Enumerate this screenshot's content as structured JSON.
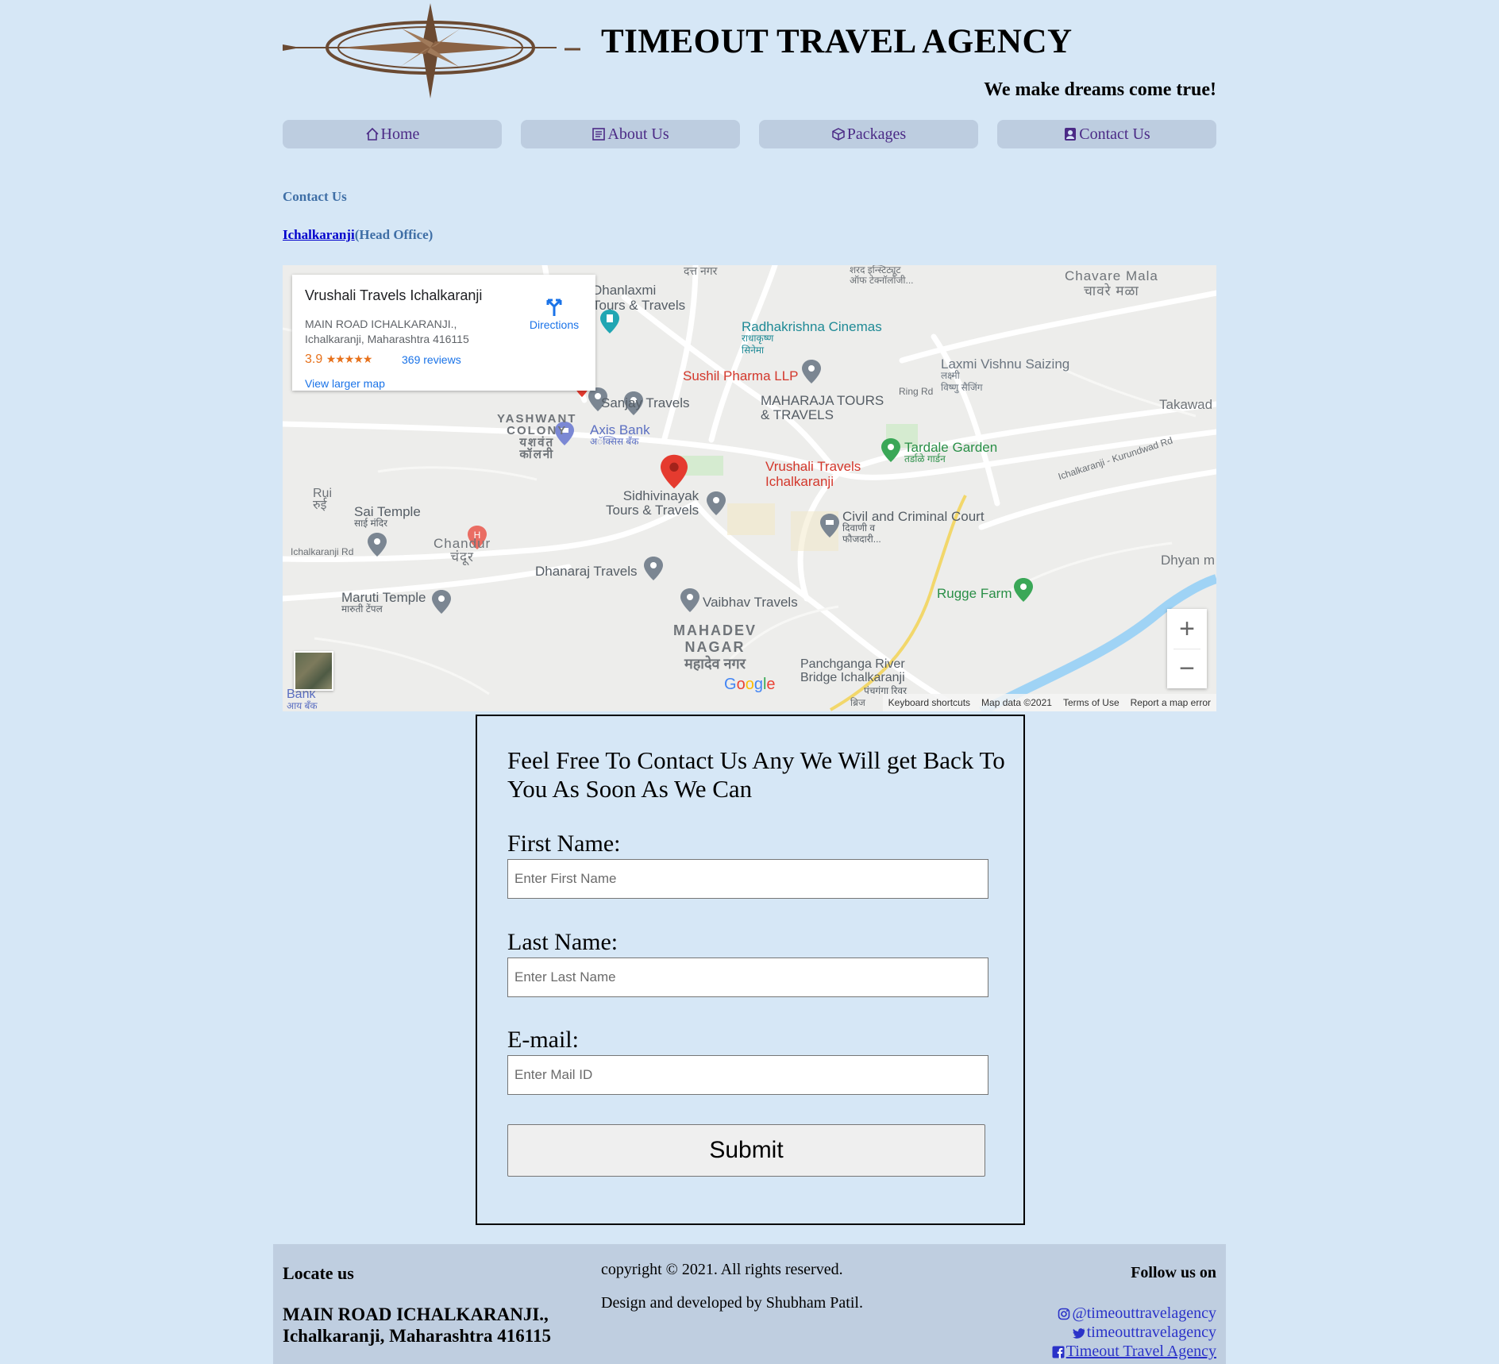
{
  "header": {
    "title": "TIMEOUT TRAVEL AGENCY",
    "tagline": "We make dreams come true!"
  },
  "nav": {
    "items": [
      {
        "label": "Home",
        "icon": "home-icon"
      },
      {
        "label": "About Us",
        "icon": "document-icon"
      },
      {
        "label": "Packages",
        "icon": "box-icon"
      },
      {
        "label": "Contact Us",
        "icon": "contact-card-icon"
      }
    ]
  },
  "page": {
    "heading": "Contact Us",
    "office_link": "Ichalkaranji",
    "office_suffix": "(Head Office)"
  },
  "map": {
    "place_name": "Vrushali Travels Ichalkaranji",
    "address_line1": "MAIN ROAD ICHALKARANJI.,",
    "address_line2": "Ichalkaranji, Maharashtra 416115",
    "rating": "3.9",
    "stars": "★★★★★",
    "reviews": "369 reviews",
    "view_larger": "View larger map",
    "directions": "Directions",
    "footer": {
      "shortcuts": "Keyboard shortcuts",
      "map_data": "Map data ©2021",
      "terms": "Terms of Use",
      "report": "Report a map error"
    },
    "labels": {
      "dhanlaxmi": "Dhanlaxmi",
      "dhanlaxmi2": "Tours & Travels",
      "radhakrishna": "Radhakrishna Cinemas",
      "radhakrishna_mr": "राधाकृष्ण",
      "radhakrishna_mr2": "सिनेमा",
      "sushil": "Sushil Pharma LLP",
      "sanjay": "Sanjay Travels",
      "maharaja": "MAHARAJA TOURS",
      "maharaja2": "& TRAVELS",
      "laxmi": "Laxmi Vishnu Saizing",
      "laxmi_mr": "लक्ष्मी",
      "laxmi_mr2": "विष्णु सैजिंग",
      "chavare": "Chavare Mala",
      "chavare_mr": "चावरे मळा",
      "takawad": "Takawad",
      "yashwant": "YASHWANT",
      "colony": "COLONY",
      "yashwant_mr": "यशवंत",
      "colony_mr": "कॉलनी",
      "axis": "Axis Bank",
      "axis_mr": "अॅक्सिस बँक",
      "tardale": "Tardale Garden",
      "tardale_mr": "तर्डाळे गार्डन",
      "vrushali": "Vrushali Travels",
      "vrushali2": "Ichalkaranji",
      "ring_rd": "Ring Rd",
      "kurundwad_rd": "Ichalkaranji - Kurundwad Rd",
      "rui": "Rui",
      "rui_mr": "रुई",
      "sai": "Sai Temple",
      "sai_mr": "साई मंदिर",
      "sidhivinayak": "Sidhivinayak",
      "sidhivinayak2": "Tours & Travels",
      "civil": "Civil and Criminal Court",
      "civil_mr": "दिवाणी व",
      "civil_mr2": "फौजदारी...",
      "chandur": "Chandur",
      "chandur_mr": "चंदूर",
      "ichal_rd": "Ichalkaranji Rd",
      "dhanaraj": "Dhanaraj Travels",
      "dhyan": "Dhyan m",
      "maruti": "Maruti Temple",
      "maruti_mr": "मारुती टेंपल",
      "vaibhav": "Vaibhav Travels",
      "rugge": "Rugge Farm",
      "mahadev": "MAHADEV",
      "nagar": "NAGAR",
      "mahadev_mr": "महादेव नगर",
      "panchganga": "Panchganga River",
      "panchganga2": "Bridge Ichalkaranji",
      "panchganga_mr": "पंचगंगा रिवर",
      "bank": "Bank",
      "bank_mr": "आय बँक",
      "top_left": "दत्त नगर",
      "top_mid": "शरद इन्स्टिट्यूट",
      "top_mid2": "ऑफ टेक्नॉलॉजी...",
      "bridge_mr": "ब्रिज"
    },
    "google": "Google"
  },
  "form": {
    "heading": "Feel Free To Contact Us Any We Will get Back To You As Soon As We Can",
    "first_name_label": "First Name:",
    "first_name_placeholder": "Enter First Name",
    "last_name_label": "Last Name:",
    "last_name_placeholder": "Enter Last Name",
    "email_label": "E-mail:",
    "email_placeholder": "Enter Mail ID",
    "submit": "Submit"
  },
  "footer": {
    "locate_title": "Locate us",
    "address_line1": "MAIN ROAD ICHALKARANJI.,",
    "address_line2": "Ichalkaranji, Maharashtra 416115",
    "copyright": "copyright © 2021. All rights reserved.",
    "credits": "Design and developed by Shubham Patil.",
    "follow_title": "Follow us on",
    "instagram": "@timeouttravelagency",
    "twitter": "timeouttravelagency",
    "facebook": "Timeout Travel Agency"
  }
}
